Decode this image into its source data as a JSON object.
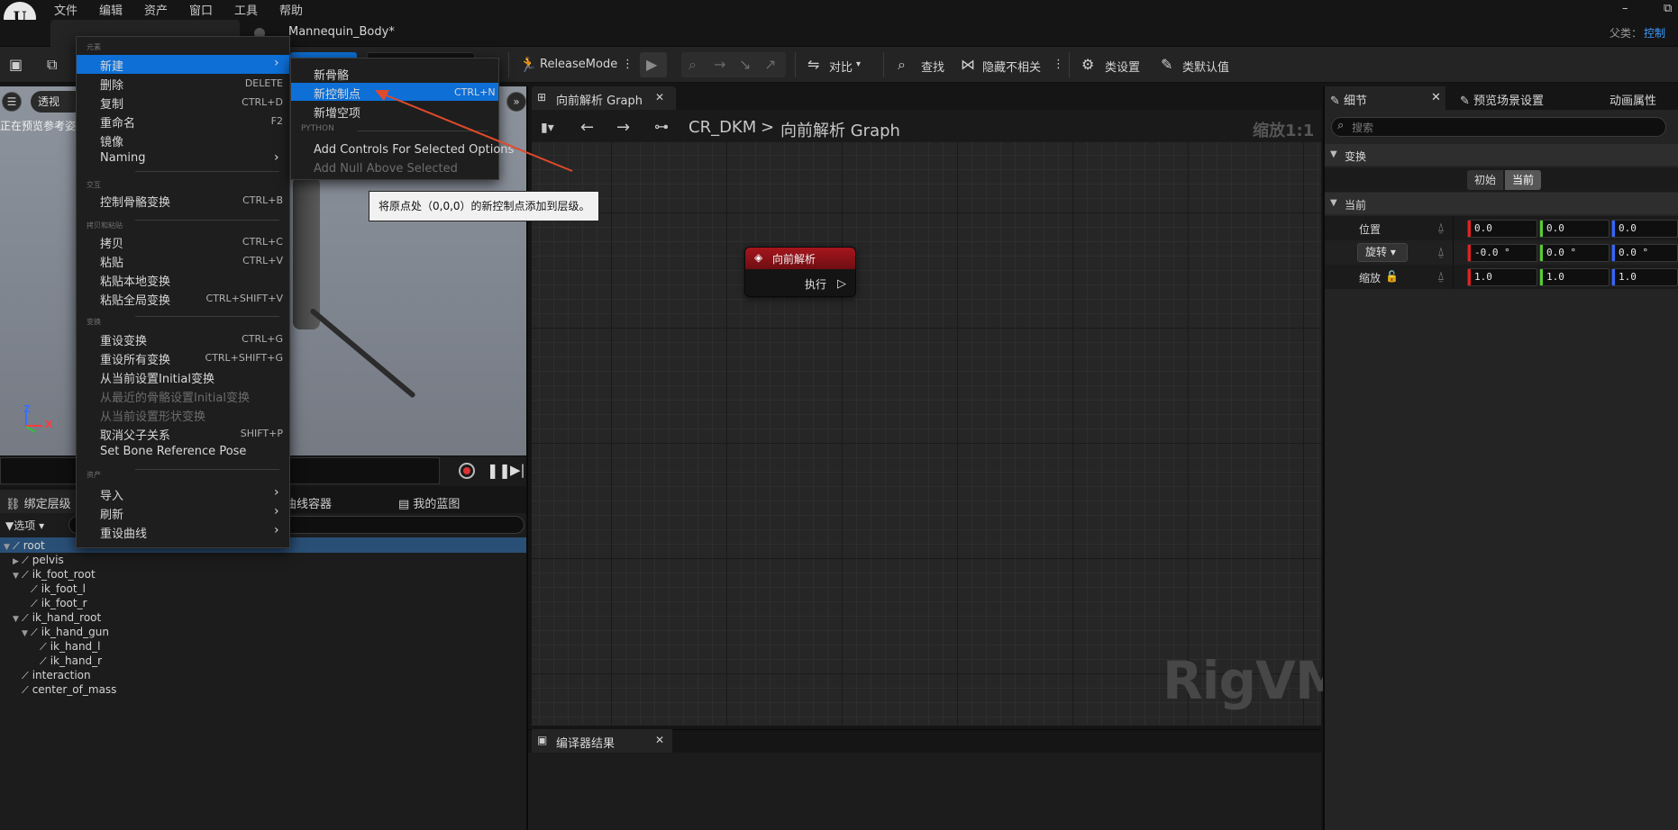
{
  "menubar": {
    "logo": "U",
    "items": [
      "文件",
      "编辑",
      "资产",
      "窗口",
      "工具",
      "帮助"
    ],
    "minimize": "–",
    "restore": "⧉",
    "parent_label": "父类：",
    "parent_value": "控制"
  },
  "doc_tab": {
    "title": "Mannequin_Body*"
  },
  "toolbar": {
    "release_mode": "ReleaseMode",
    "compare": "对比",
    "find": "查找",
    "hide_unrelated": "隐藏不相关",
    "class_settings": "类设置",
    "class_defaults": "类默认值"
  },
  "viewport": {
    "menu_icon": "☰",
    "perspective": "透视",
    "preview_text": "正在预览参考姿",
    "axis_z": "Z",
    "axis_x": "X"
  },
  "hierarchy": {
    "tabs": [
      "绑定层级",
      "曲线容器",
      "我的蓝图"
    ],
    "options": "选项",
    "items": [
      {
        "label": "root",
        "depth": 0,
        "expanded": true
      },
      {
        "label": "pelvis",
        "depth": 1,
        "expanded": false
      },
      {
        "label": "ik_foot_root",
        "depth": 1,
        "expanded": true
      },
      {
        "label": "ik_foot_l",
        "depth": 2
      },
      {
        "label": "ik_foot_r",
        "depth": 2
      },
      {
        "label": "ik_hand_root",
        "depth": 1,
        "expanded": true
      },
      {
        "label": "ik_hand_gun",
        "depth": 2,
        "expanded": true
      },
      {
        "label": "ik_hand_l",
        "depth": 3
      },
      {
        "label": "ik_hand_r",
        "depth": 3
      },
      {
        "label": "interaction",
        "depth": 1
      },
      {
        "label": "center_of_mass",
        "depth": 1
      }
    ]
  },
  "context_menu": {
    "sections": {
      "elements": "元素",
      "interaction": "交互",
      "copy_paste": "拷贝和粘贴",
      "transforms": "变换",
      "assets": "资产"
    },
    "items": [
      {
        "label": "新建",
        "shortcut": "",
        "submenu": true,
        "highlighted": true
      },
      {
        "label": "删除",
        "shortcut": "DELETE"
      },
      {
        "label": "复制",
        "shortcut": "CTRL+D"
      },
      {
        "label": "重命名",
        "shortcut": "F2"
      },
      {
        "label": "镜像",
        "shortcut": ""
      },
      {
        "label": "Naming",
        "shortcut": "",
        "submenu": true
      },
      {
        "label": "控制骨骼变换",
        "shortcut": "CTRL+B"
      },
      {
        "label": "拷贝",
        "shortcut": "CTRL+C"
      },
      {
        "label": "粘贴",
        "shortcut": "CTRL+V"
      },
      {
        "label": "粘贴本地变换",
        "shortcut": ""
      },
      {
        "label": "粘贴全局变换",
        "shortcut": "CTRL+SHIFT+V"
      },
      {
        "label": "重设变换",
        "shortcut": "CTRL+G"
      },
      {
        "label": "重设所有变换",
        "shortcut": "CTRL+SHIFT+G"
      },
      {
        "label": "从当前设置Initial变换",
        "shortcut": ""
      },
      {
        "label": "从最近的骨骼设置Initial变换",
        "shortcut": "",
        "disabled": true
      },
      {
        "label": "从当前设置形状变换",
        "shortcut": "",
        "disabled": true
      },
      {
        "label": "取消父子关系",
        "shortcut": "SHIFT+P"
      },
      {
        "label": "Set Bone Reference Pose",
        "shortcut": ""
      },
      {
        "label": "导入",
        "shortcut": "",
        "submenu": true
      },
      {
        "label": "刷新",
        "shortcut": "",
        "submenu": true
      },
      {
        "label": "重设曲线",
        "shortcut": "",
        "submenu": true
      }
    ]
  },
  "submenu": {
    "python_section": "PYTHON",
    "items": [
      {
        "label": "新骨骼",
        "shortcut": ""
      },
      {
        "label": "新控制点",
        "shortcut": "CTRL+N",
        "highlighted": true
      },
      {
        "label": "新增空项",
        "shortcut": ""
      },
      {
        "label": "Add Controls For Selected Options",
        "shortcut": ""
      },
      {
        "label": "Add Null Above Selected",
        "shortcut": "",
        "disabled": true
      }
    ]
  },
  "tooltip": {
    "text": "将原点处（0,0,0）的新控制点添加到层级。"
  },
  "graph": {
    "tab_label": "向前解析 Graph",
    "close": "✕",
    "breadcrumb_root": "CR_DKM",
    "breadcrumb_sep": ">",
    "breadcrumb_graph": "向前解析 Graph",
    "zoom": "缩放1:1",
    "watermark": "RigVM",
    "node": {
      "title": "向前解析",
      "exec": "执行"
    }
  },
  "compiler": {
    "tab_label": "编译器结果",
    "close": "✕"
  },
  "details": {
    "tabs": [
      "细节",
      "预览场景设置",
      "动画属性"
    ],
    "close": "✕",
    "search_placeholder": "搜索",
    "transform_category": "变换",
    "seg_initial": "初始",
    "seg_current": "当前",
    "current_category": "当前",
    "location_label": "位置",
    "rotation_label": "旋转",
    "scale_label": "缩放",
    "location": [
      "0.0",
      "0.0",
      "0.0"
    ],
    "rotation": [
      "-0.0 °",
      "0.0 °",
      "0.0 °"
    ],
    "scale": [
      "1.0",
      "1.0",
      "1.0"
    ]
  },
  "colors": {
    "accent": "#0e6fd6",
    "node_header": "#a5161c",
    "annotation_arrow": "#e04a2a",
    "tree_selection": "#2a4f76"
  }
}
